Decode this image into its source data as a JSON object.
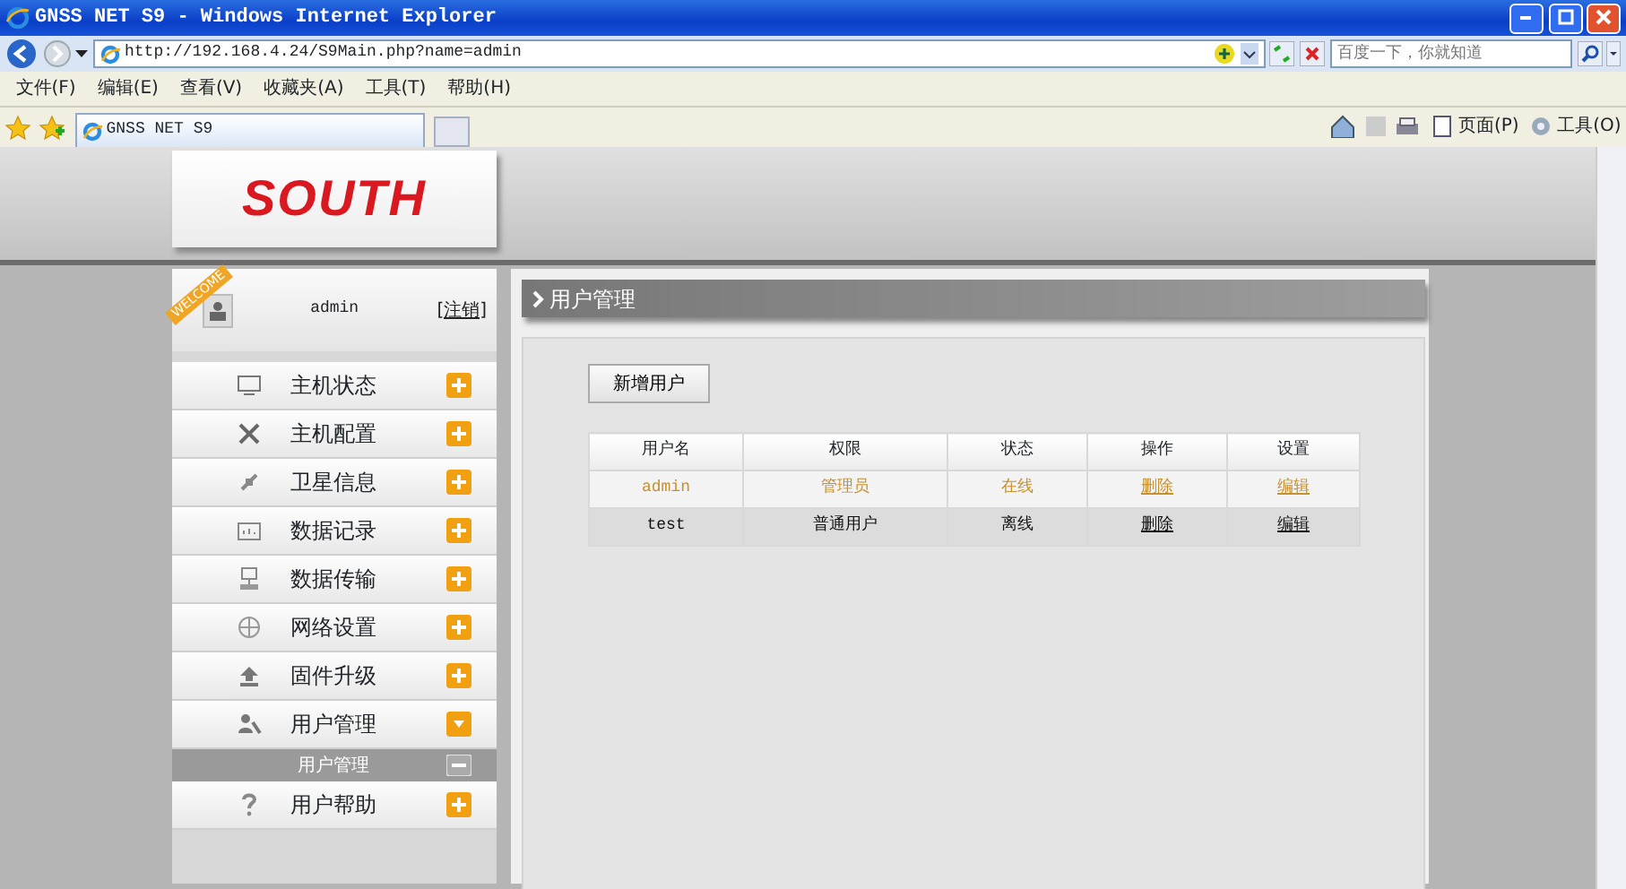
{
  "window": {
    "title": "GNSS NET S9 - Windows Internet Explorer"
  },
  "address_bar": {
    "url": "http://192.168.4.24/S9Main.php?name=admin"
  },
  "search": {
    "placeholder": "百度一下，你就知道"
  },
  "menu": [
    "文件(F)",
    "编辑(E)",
    "查看(V)",
    "收藏夹(A)",
    "工具(T)",
    "帮助(H)"
  ],
  "tabs": [
    {
      "label": "GNSS NET S9",
      "selected": true
    }
  ],
  "command_bar": [
    {
      "label": "页面(P)"
    },
    {
      "label": "工具(O)"
    }
  ],
  "page": {
    "logo": "SOUTH",
    "welcome": {
      "ribbon": "WELCOME",
      "user": "admin",
      "logout": "[注销]"
    },
    "sidebar": {
      "items": [
        {
          "label": "主机状态",
          "expanded": false
        },
        {
          "label": "主机配置",
          "expanded": false
        },
        {
          "label": "卫星信息",
          "expanded": false
        },
        {
          "label": "数据记录",
          "expanded": false
        },
        {
          "label": "数据传输",
          "expanded": false
        },
        {
          "label": "网络设置",
          "expanded": false
        },
        {
          "label": "固件升级",
          "expanded": false
        },
        {
          "label": "用户管理",
          "expanded": true,
          "children": [
            {
              "label": "用户管理",
              "selected": true
            }
          ]
        },
        {
          "label": "用户帮助",
          "expanded": false
        }
      ]
    },
    "content": {
      "heading": "用户管理",
      "add_button": "新增用户",
      "table": {
        "columns": [
          "用户名",
          "权限",
          "状态",
          "操作",
          "设置"
        ],
        "rows": [
          {
            "cells": [
              "admin",
              "管理员",
              "在线"
            ],
            "actions": [
              "删除",
              "编辑"
            ],
            "selected": true
          },
          {
            "cells": [
              "test",
              "普通用户",
              "离线"
            ],
            "actions": [
              "删除",
              "编辑"
            ],
            "selected": false
          }
        ]
      }
    }
  }
}
